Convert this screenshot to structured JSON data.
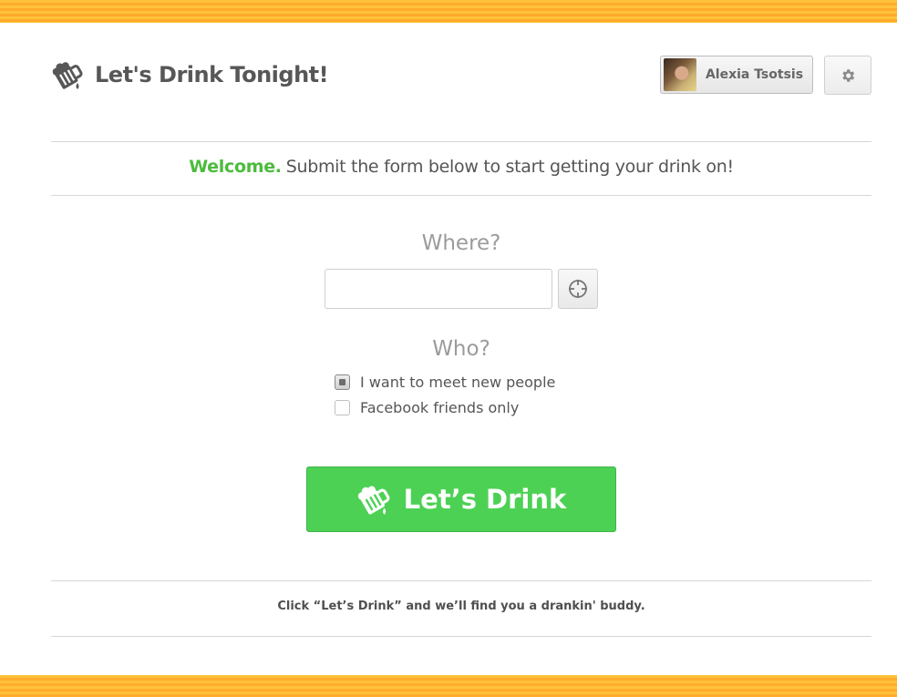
{
  "header": {
    "title": "Let's Drink Tonight!",
    "logo_icon": "beer-mug-icon",
    "user_name": "Alexia Tsotsis",
    "settings_icon": "gear-icon"
  },
  "welcome": {
    "highlight": "Welcome.",
    "text": "Submit the form below to start getting your drink on!",
    "highlight_color": "#4cbb3d"
  },
  "form": {
    "where_label": "Where?",
    "where_value": "",
    "locate_icon": "crosshair-icon",
    "who_label": "Who?",
    "options": [
      {
        "label": "I want to meet new people",
        "checked": true
      },
      {
        "label": "Facebook friends only",
        "checked": false
      }
    ],
    "submit_label": "Let’s Drink",
    "submit_color": "#4cd154"
  },
  "footer": {
    "note": "Click “Let’s Drink” and we’ll find you a drankin' buddy."
  },
  "colors": {
    "stripe": "#ffb22f"
  }
}
